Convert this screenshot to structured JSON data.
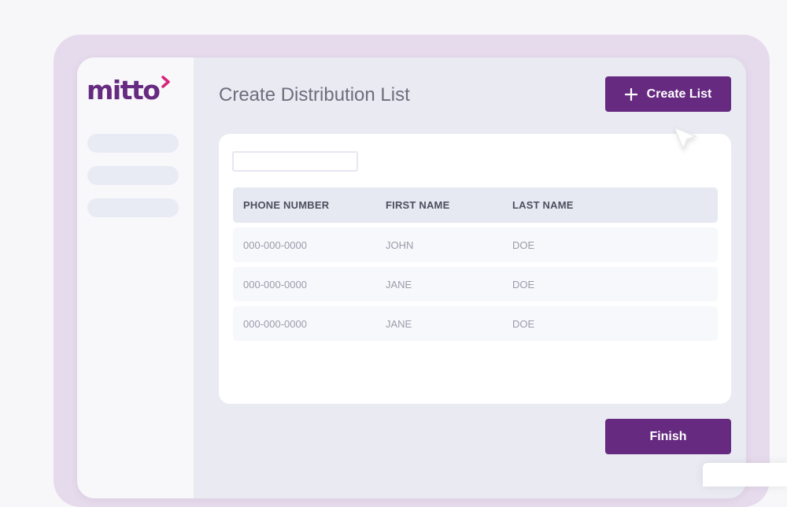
{
  "colors": {
    "brand_purple": "#662a80",
    "brand_pink": "#d6247a",
    "frame": "#e6dbec",
    "window_bg": "#e9eaf2"
  },
  "logo": {
    "text": "mitto",
    "icon": "chevron-right-icon"
  },
  "header": {
    "title": "Create Distribution List"
  },
  "toolbar": {
    "create_label": "Create List",
    "create_icon": "plus-icon"
  },
  "search": {
    "value": "",
    "placeholder": ""
  },
  "table": {
    "columns": [
      "PHONE NUMBER",
      "FIRST NAME",
      "LAST NAME"
    ],
    "rows": [
      [
        "000-000-0000",
        "JOHN",
        "DOE"
      ],
      [
        "000-000-0000",
        "JANE",
        "DOE"
      ],
      [
        "000-000-0000",
        "JANE",
        "DOE"
      ]
    ]
  },
  "footer": {
    "finish_label": "Finish"
  },
  "sidebar": {
    "items": [
      "",
      "",
      ""
    ]
  },
  "pointer": {
    "icon": "mouse-pointer-icon"
  }
}
